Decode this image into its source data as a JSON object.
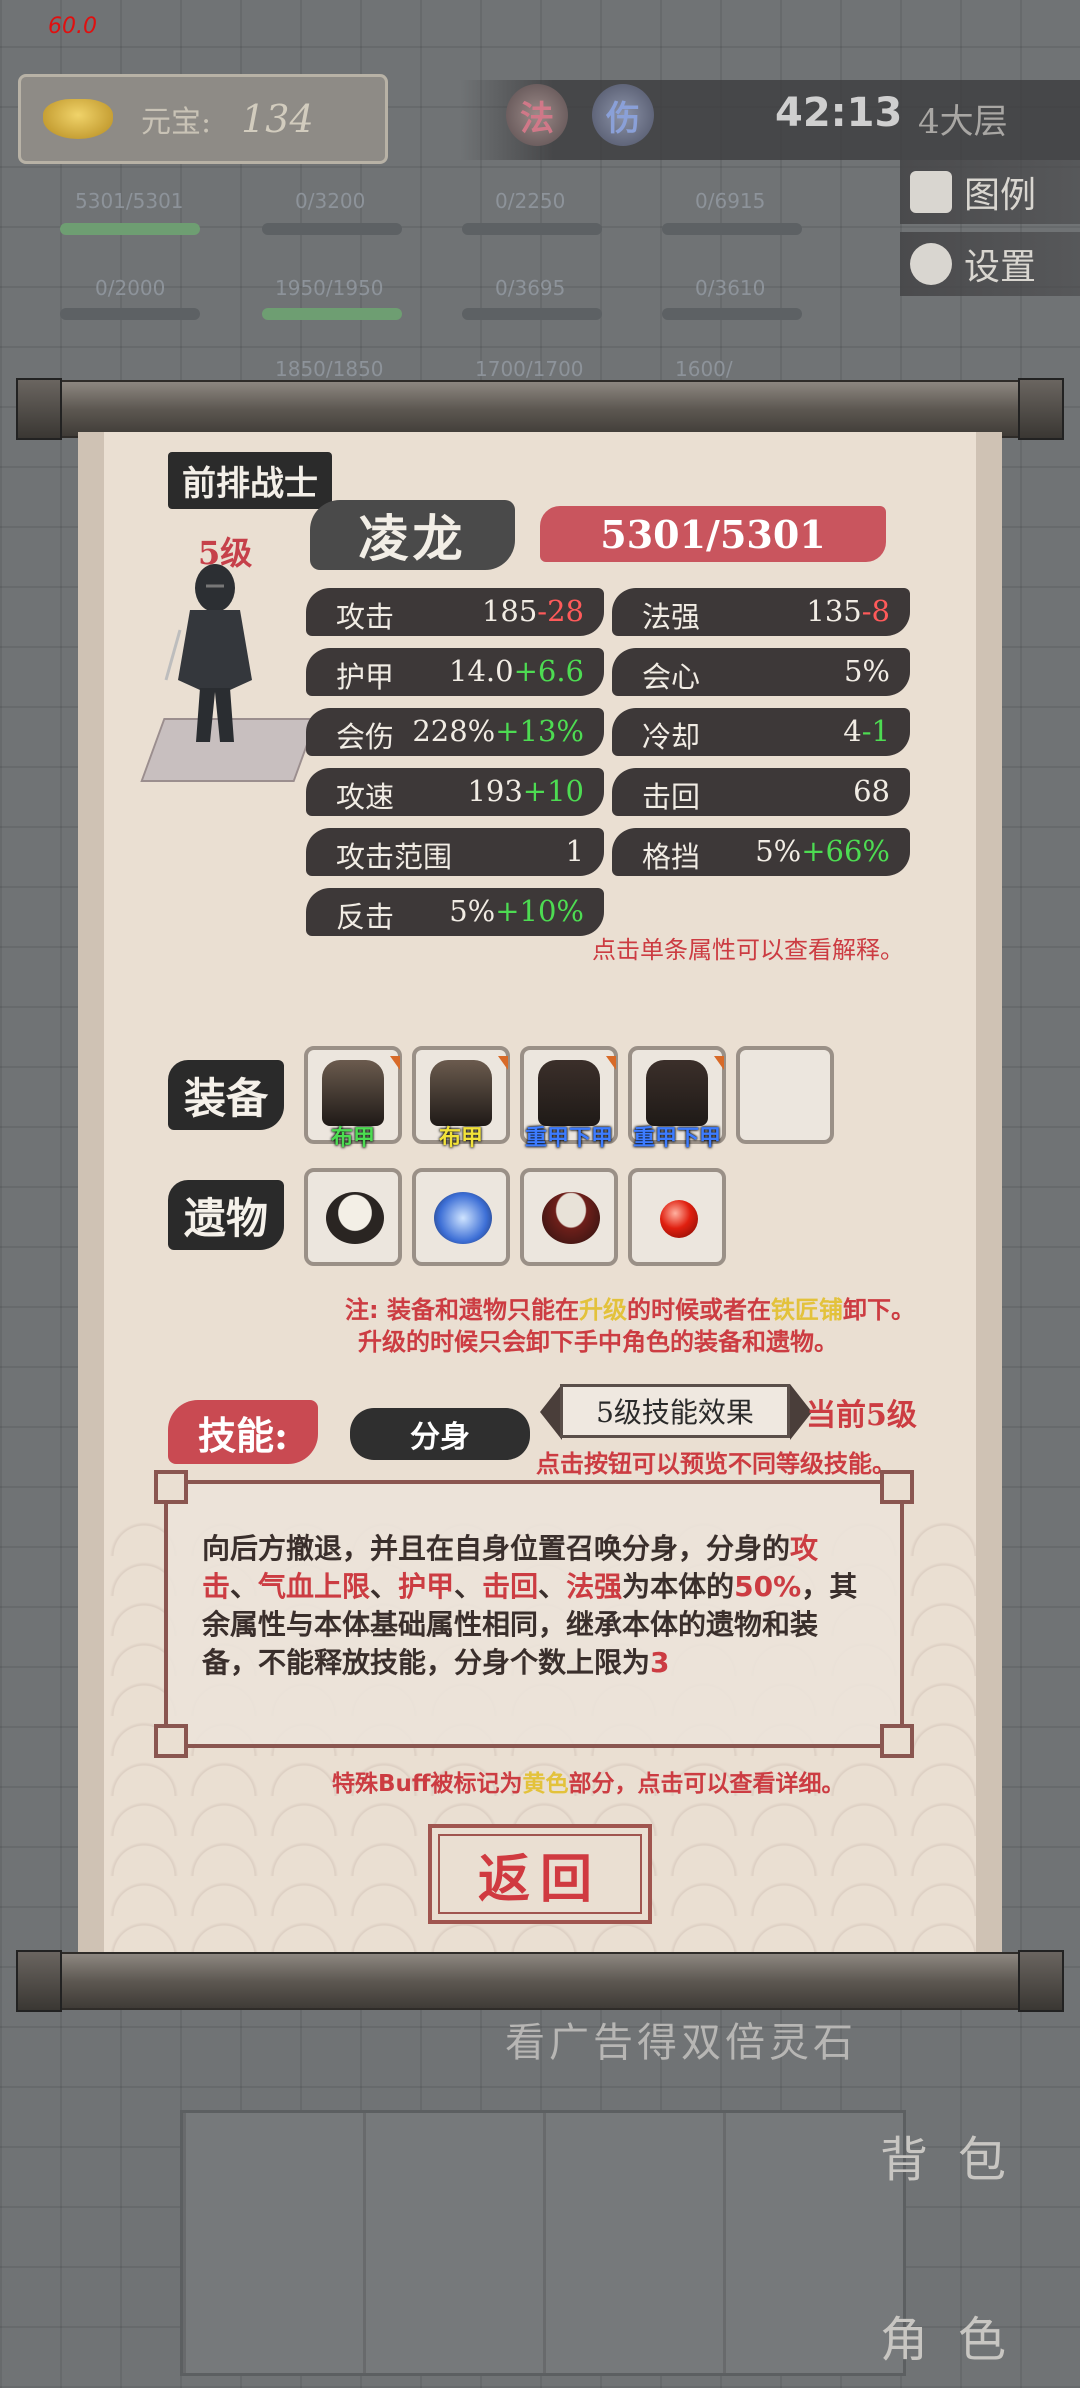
{
  "hud": {
    "fps": "60.0",
    "currency_label": "元宝:",
    "currency_value": "134",
    "elements": [
      "法",
      "伤"
    ],
    "timer": "42:13",
    "floor": "4大层",
    "legend_button": "图例",
    "settings_button": "设置"
  },
  "background_units": {
    "row1": [
      "5301/5301",
      "0/3200",
      "0/2250",
      "0/6915"
    ],
    "row2": [
      "0/2000",
      "1950/1950",
      "0/3695",
      "0/3610"
    ],
    "row3": [
      "1850/1850",
      "1700/1700",
      "1600/"
    ]
  },
  "bottom": {
    "ad_text": "看广告得双倍灵石",
    "bag_button": "背包",
    "role_button": "角色"
  },
  "character": {
    "role_tag": "前排战士",
    "level": "5级",
    "name": "凌龙",
    "hp": "5301/5301",
    "stats": [
      {
        "key": "攻击",
        "base": "185",
        "bonus": "-28",
        "bonus_type": "neg"
      },
      {
        "key": "法强",
        "base": "135",
        "bonus": "-8",
        "bonus_type": "neg"
      },
      {
        "key": "护甲",
        "base": "14.0",
        "bonus": "+6.6",
        "bonus_type": "pos"
      },
      {
        "key": "会心",
        "base": "5%",
        "bonus": "",
        "bonus_type": ""
      },
      {
        "key": "会伤",
        "base": "228%",
        "bonus": "+13%",
        "bonus_type": "pos"
      },
      {
        "key": "冷却",
        "base": "4",
        "bonus": "-1",
        "bonus_type": "pos"
      },
      {
        "key": "攻速",
        "base": "193",
        "bonus": "+10",
        "bonus_type": "pos"
      },
      {
        "key": "击回",
        "base": "68",
        "bonus": "",
        "bonus_type": ""
      },
      {
        "key": "攻击范围",
        "base": "1",
        "bonus": "",
        "bonus_type": ""
      },
      {
        "key": "格挡",
        "base": "5%",
        "bonus": "+66%",
        "bonus_type": "pos"
      },
      {
        "key": "反击",
        "base": "5%",
        "bonus": "+10%",
        "bonus_type": "pos"
      }
    ],
    "stat_hint": "点击单条属性可以查看解释。"
  },
  "equipment": {
    "label": "装备",
    "slots": [
      {
        "name": "布甲",
        "color": "#4ddc52"
      },
      {
        "name": "布甲",
        "color": "#f2e23a"
      },
      {
        "name": "重甲下甲",
        "color": "#3d7cff"
      },
      {
        "name": "重甲下甲",
        "color": "#3d7cff"
      },
      {
        "name": "",
        "color": ""
      }
    ]
  },
  "relics": {
    "label": "遗物",
    "items": [
      "drum-icon",
      "lightning-orb-icon",
      "war-drum-icon",
      "red-pearl-icon"
    ]
  },
  "notes": {
    "line1_a": "注: 装备和遗物只能在",
    "line1_b": "升级",
    "line1_c": "的时候或者在",
    "line1_d": "铁匠铺",
    "line1_e": "卸下。",
    "line2": "升级的时候只会卸下手中角色的装备和遗物。"
  },
  "skill": {
    "label": "技能:",
    "name": "分身",
    "preview_button": "5级技能效果",
    "current_level": "当前5级",
    "hint": "点击按钮可以预览不同等级技能。",
    "desc": [
      {
        "t": "向后方撤退，并且在自身位置召唤分身，分身的",
        "r": false
      },
      {
        "t": "攻击",
        "r": true
      },
      {
        "t": "、",
        "r": false
      },
      {
        "t": "气血上限",
        "r": true
      },
      {
        "t": "、",
        "r": false
      },
      {
        "t": "护甲",
        "r": true
      },
      {
        "t": "、",
        "r": false
      },
      {
        "t": "击回",
        "r": true
      },
      {
        "t": "、",
        "r": false
      },
      {
        "t": "法强",
        "r": true
      },
      {
        "t": "为本体的",
        "r": false
      },
      {
        "t": "50%",
        "r": true
      },
      {
        "t": "，其余属性与本体基础属性相同，继承本体的遗物和装备，不能释放技能，分身个数上限为",
        "r": false
      },
      {
        "t": "3",
        "r": true
      }
    ],
    "buff_hint_a": "特殊Buff被标记为",
    "buff_hint_b": "黄色",
    "buff_hint_c": "部分，点击可以查看详细。"
  },
  "return_button": "返回",
  "colors": {
    "accent_red": "#cc3c42",
    "stat_bg": "#3d3838",
    "scroll_bg": "#eadfd2",
    "positive": "#4ddc52",
    "negative": "#ff5a5a",
    "highlight_yellow": "#e3c23b"
  }
}
